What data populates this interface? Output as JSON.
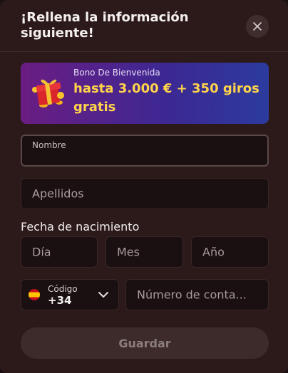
{
  "modal": {
    "title": "¡Rellena la información siguiente!",
    "close_icon": "close-icon"
  },
  "bonus": {
    "subtitle": "Bono De Bienvenida",
    "headline": "hasta 3.000 € + 350 giros gratis",
    "icon": "gift-icon"
  },
  "form": {
    "first_name": {
      "label": "Nombre",
      "value": ""
    },
    "last_name": {
      "placeholder": "Apellidos"
    },
    "birthdate": {
      "label": "Fecha de nacimiento",
      "day_placeholder": "Día",
      "month_placeholder": "Mes",
      "year_placeholder": "Año"
    },
    "phone": {
      "code_label": "Código",
      "code_value": "+34",
      "flag": "spain-flag-icon",
      "number_placeholder": "Número de conta..."
    },
    "save_label": "Guardar"
  },
  "colors": {
    "background": "#2c1a1a",
    "input_bg": "#1b1011",
    "accent_gold": "#ffd44a",
    "banner_gradient_start": "#6a1d82",
    "banner_gradient_end": "#2c3b9e",
    "button_disabled": "#3d2b2b"
  }
}
